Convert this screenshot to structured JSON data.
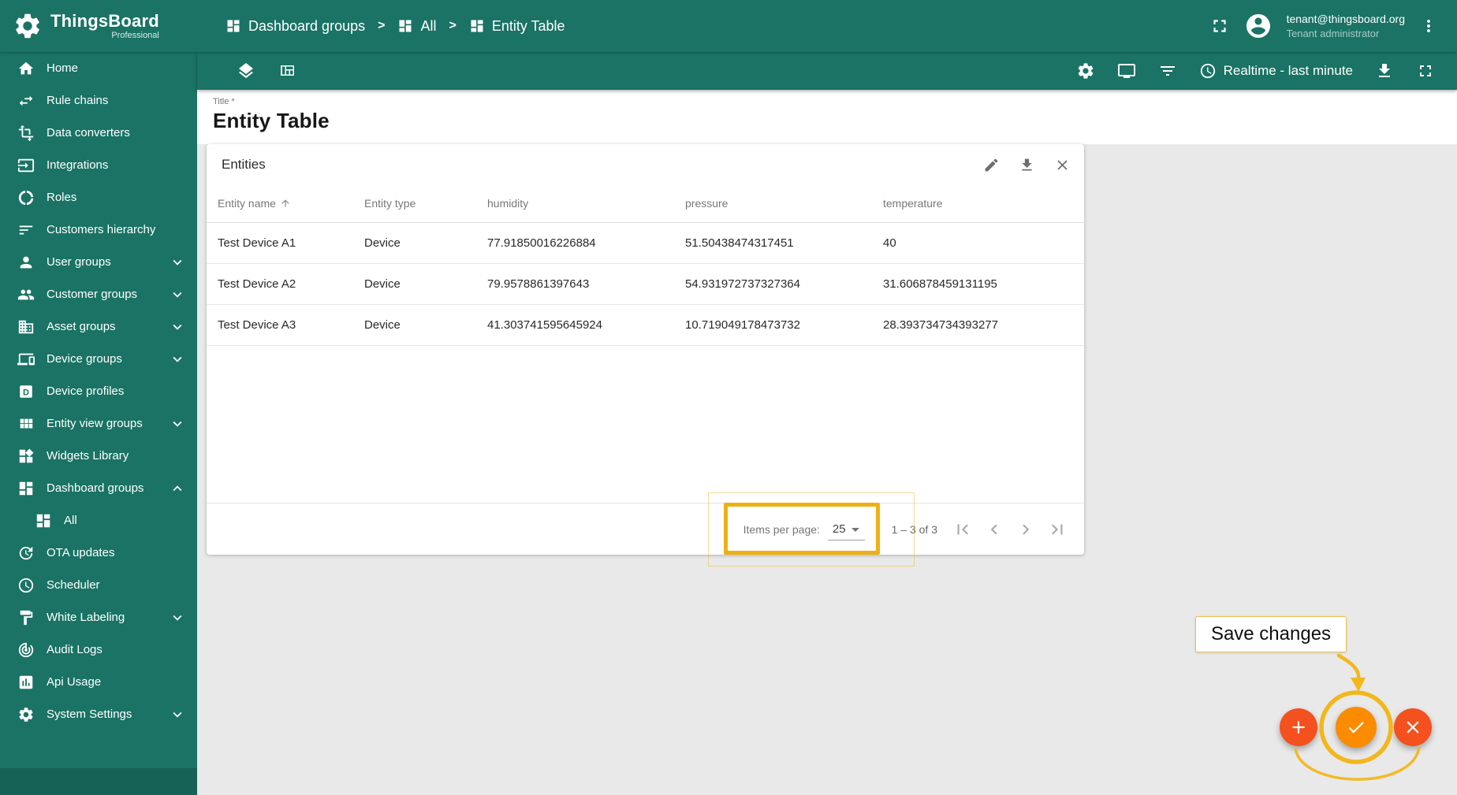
{
  "app": {
    "name": "ThingsBoard",
    "edition": "Professional"
  },
  "header": {
    "breadcrumb": [
      {
        "label": "Dashboard groups",
        "icon": "dashboards"
      },
      {
        "label": "All",
        "icon": "dashboards"
      },
      {
        "label": "Entity Table",
        "icon": "dashboards"
      }
    ],
    "user_email": "tenant@thingsboard.org",
    "user_role": "Tenant administrator"
  },
  "toolbar": {
    "left_icons": [
      {
        "name": "dashboard-states",
        "icon": "layers"
      },
      {
        "name": "manage-layouts",
        "icon": "view-quilt"
      }
    ],
    "right_icons_before": [
      {
        "name": "dashboard-settings",
        "icon": "settings"
      },
      {
        "name": "entity-aliases",
        "icon": "tv"
      },
      {
        "name": "filters",
        "icon": "filter-list"
      }
    ],
    "timewindow": {
      "icon": "schedule",
      "label": "Realtime - last minute"
    },
    "right_icons_after": [
      {
        "name": "export-dashboard",
        "icon": "download"
      },
      {
        "name": "fullscreen",
        "icon": "fullscreen"
      }
    ]
  },
  "sidebar": {
    "items": [
      {
        "label": "Home",
        "icon": "home"
      },
      {
        "label": "Rule chains",
        "icon": "swap-horiz"
      },
      {
        "label": "Data converters",
        "icon": "transform"
      },
      {
        "label": "Integrations",
        "icon": "input"
      },
      {
        "label": "Roles",
        "icon": "donut"
      },
      {
        "label": "Customers hierarchy",
        "icon": "sort"
      },
      {
        "label": "User groups",
        "icon": "person",
        "chevron": "down"
      },
      {
        "label": "Customer groups",
        "icon": "people",
        "chevron": "down"
      },
      {
        "label": "Asset groups",
        "icon": "domain",
        "chevron": "down"
      },
      {
        "label": "Device groups",
        "icon": "devices",
        "chevron": "down"
      },
      {
        "label": "Device profiles",
        "icon": "device-profile"
      },
      {
        "label": "Entity view groups",
        "icon": "view-module",
        "chevron": "down"
      },
      {
        "label": "Widgets Library",
        "icon": "widgets"
      },
      {
        "label": "Dashboard groups",
        "icon": "dashboards",
        "chevron": "up"
      },
      {
        "label": "All",
        "icon": "dashboards",
        "sub": true
      },
      {
        "label": "OTA updates",
        "icon": "update"
      },
      {
        "label": "Scheduler",
        "icon": "schedule"
      },
      {
        "label": "White Labeling",
        "icon": "format-paint",
        "chevron": "down"
      },
      {
        "label": "Audit Logs",
        "icon": "track-changes"
      },
      {
        "label": "Api Usage",
        "icon": "insert-chart"
      },
      {
        "label": "System Settings",
        "icon": "settings",
        "chevron": "down"
      }
    ]
  },
  "dashboard": {
    "title_field_label": "Title *",
    "title": "Entity Table"
  },
  "widget": {
    "title": "Entities",
    "actions": [
      {
        "name": "edit-widget",
        "icon": "edit"
      },
      {
        "name": "export-widget",
        "icon": "download"
      },
      {
        "name": "remove-widget",
        "icon": "close"
      }
    ],
    "table": {
      "columns": [
        "Entity name",
        "Entity type",
        "humidity",
        "pressure",
        "temperature"
      ],
      "sorted_column": "Entity name",
      "sort_direction": "asc",
      "rows": [
        [
          "Test Device A1",
          "Device",
          "77.91850016226884",
          "51.50438474317451",
          "40"
        ],
        [
          "Test Device A2",
          "Device",
          "79.9578861397643",
          "54.931972737327364",
          "31.606878459131195"
        ],
        [
          "Test Device A3",
          "Device",
          "41.303741595645924",
          "10.719049178473732",
          "28.393734734393277"
        ]
      ]
    },
    "paginator": {
      "items_per_page_label": "Items per page:",
      "items_per_page": "25",
      "range": "1 – 3 of 3",
      "nav_buttons": [
        {
          "name": "first-page",
          "icon": "first-page"
        },
        {
          "name": "previous-page",
          "icon": "chevron-left"
        },
        {
          "name": "next-page",
          "icon": "chevron-right"
        },
        {
          "name": "last-page",
          "icon": "last-page"
        }
      ]
    }
  },
  "annotation": {
    "save_label": "Save changes"
  },
  "fabs": [
    {
      "name": "add-widget",
      "icon": "add",
      "color": "#f4511e"
    },
    {
      "name": "apply-changes",
      "icon": "check",
      "color": "#fb8c00"
    },
    {
      "name": "cancel-changes",
      "icon": "close",
      "color": "#f4511e"
    }
  ],
  "colors": {
    "primary_teal": "#1a7365",
    "background_gray": "#e9e9e9",
    "fab_orange": "#f4511e",
    "fab_apply_orange": "#fb8c00",
    "highlight_yellow": "#edb015"
  }
}
